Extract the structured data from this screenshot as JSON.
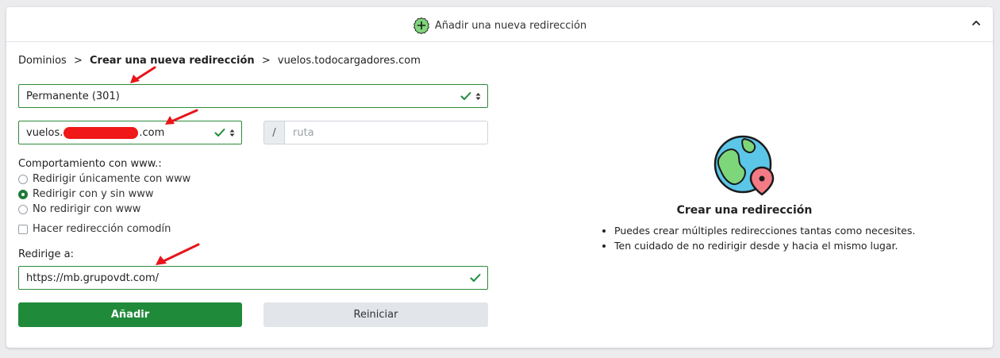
{
  "header": {
    "title": "Añadir una nueva redirección"
  },
  "breadcrumb": {
    "root": "Dominios",
    "sep": ">",
    "current": "Crear una nueva redirección",
    "domain": "vuelos.todocargadores.com"
  },
  "form": {
    "redirect_type": "Permanente (301)",
    "source_prefix": "vuelos.",
    "source_suffix": ".com",
    "path_separator": "/",
    "path_placeholder": "ruta",
    "www_label": "Comportamiento con www.:",
    "www_options": [
      {
        "label": "Redirigir únicamente con www",
        "selected": false
      },
      {
        "label": "Redirigir con y sin www",
        "selected": true
      },
      {
        "label": "No redirigir con www",
        "selected": false
      }
    ],
    "wildcard_label": "Hacer redirección comodín",
    "target_label": "Redirige a:",
    "target_value": "https://mb.grupovdt.com/",
    "add_button": "Añadir",
    "reset_button": "Reiniciar"
  },
  "info": {
    "title": "Crear una redirección",
    "bullets": [
      "Puedes crear múltiples redirecciones tantas como necesites.",
      "Ten cuidado de no redirigir desde y hacia el mismo lugar."
    ]
  },
  "colors": {
    "accent_green": "#1f8a3a",
    "field_border_green": "#2e8b3a",
    "annotation_red": "#e8141a"
  }
}
